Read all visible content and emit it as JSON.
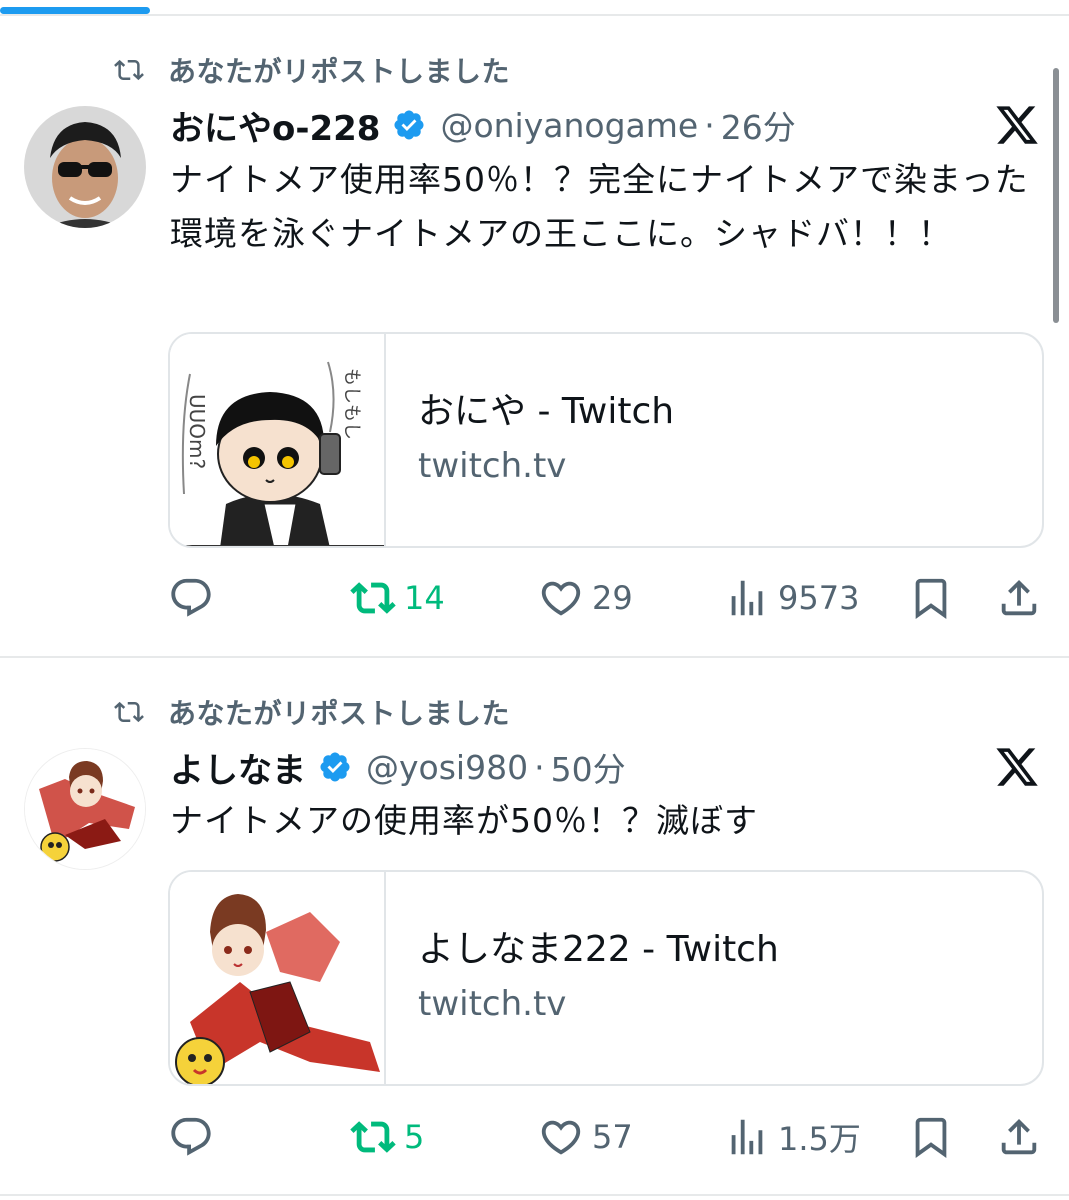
{
  "tweets": [
    {
      "repost_label": "あなたがリポストしました",
      "display_name": "おにやo-228",
      "handle": "@oniyanogame",
      "separator": "·",
      "time": "26分",
      "text": "ナイトメア使用率50％！？完全にナイトメアで染まった環境を泳ぐナイトメアの王ここに。シャドバ！！！",
      "card": {
        "title": "おにや - Twitch",
        "domain": "twitch.tv"
      },
      "actions": {
        "replies": "",
        "reposts": "14",
        "likes": "29",
        "views": "9573"
      }
    },
    {
      "repost_label": "あなたがリポストしました",
      "display_name": "よしなま",
      "handle": "@yosi980",
      "separator": "·",
      "time": "50分",
      "text": "ナイトメアの使用率が50％！？滅ぼす",
      "card": {
        "title": "よしなま222 - Twitch",
        "domain": "twitch.tv"
      },
      "actions": {
        "replies": "",
        "reposts": "5",
        "likes": "57",
        "views": "1.5万"
      }
    }
  ],
  "colors": {
    "accent": "#1d9bf0",
    "repost_green": "#00ba7c",
    "secondary_text": "#536471",
    "primary_text": "#0f1419",
    "divider": "#e7e9ea"
  },
  "icons": [
    "repost-icon",
    "verified-badge-icon",
    "x-logo-icon",
    "reply-icon",
    "like-icon",
    "views-icon",
    "bookmark-icon",
    "share-icon"
  ]
}
